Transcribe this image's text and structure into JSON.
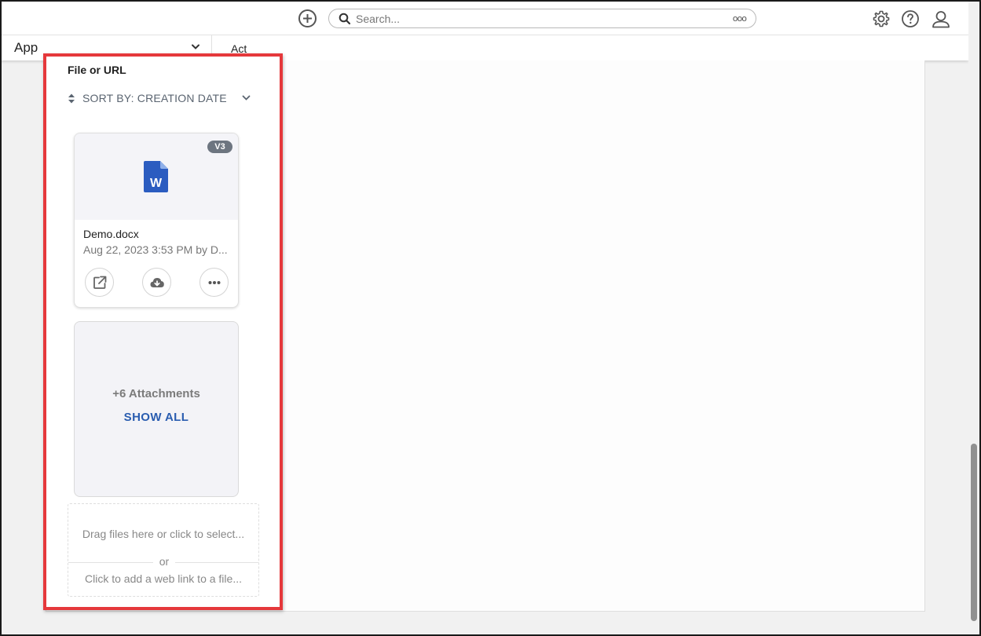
{
  "topbar": {
    "add_icon": "plus-circle-icon",
    "search": {
      "placeholder": "Search...",
      "more_icon": "ooo",
      "icon": "search-icon"
    },
    "icons": [
      "gear-icon",
      "help-icon",
      "user-icon"
    ]
  },
  "app_bar": {
    "app_label": "App",
    "act_label": "Act"
  },
  "panel": {
    "title": "File or URL",
    "sort_label": "SORT BY: CREATION DATE",
    "files": [
      {
        "version": "V3",
        "name": "Demo.docx",
        "meta": "Aug 22, 2023 3:53 PM by D...",
        "icon": "word-document-icon",
        "actions": [
          "open-external-icon",
          "cloud-download-icon",
          "more-options-icon"
        ]
      }
    ],
    "attachments": {
      "count_label": "+6 Attachments",
      "show_all_label": "SHOW ALL"
    },
    "dropzone": {
      "drag_text": "Drag files here or click to select...",
      "or_text": "or",
      "link_text": "Click to add a web link to a file..."
    }
  },
  "colors": {
    "highlight": "#e5383b",
    "link": "#2a5db0",
    "word_blue": "#2b5cc0",
    "badge": "#6d7580"
  }
}
